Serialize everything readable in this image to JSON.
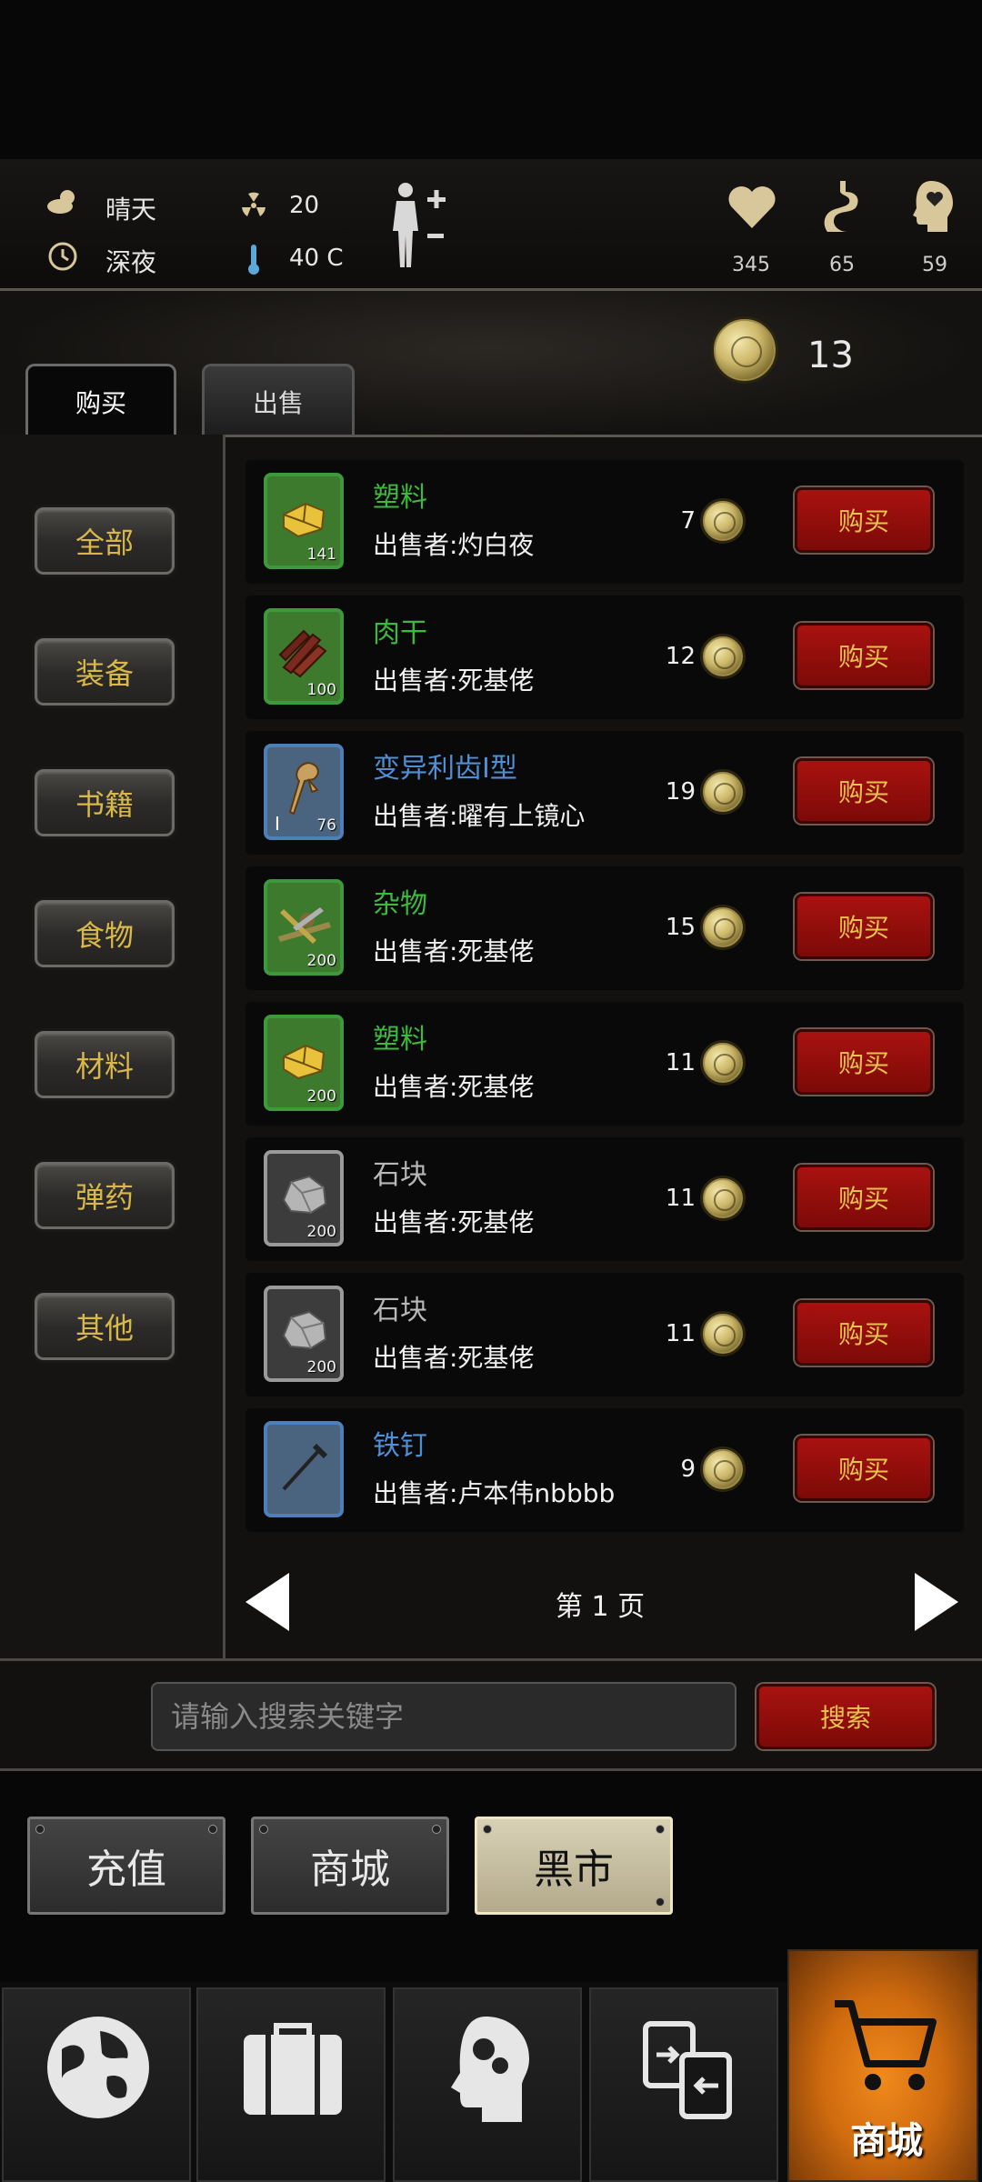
{
  "status": {
    "weather": "晴天",
    "time_of_day": "深夜",
    "radiation": "20",
    "temperature": "40 C",
    "health": "345",
    "hunger": "65",
    "sanity": "59"
  },
  "coins": "13",
  "tabs": {
    "buy": "购买",
    "sell": "出售"
  },
  "categories": [
    "全部",
    "装备",
    "书籍",
    "食物",
    "材料",
    "弹药",
    "其他"
  ],
  "items": [
    {
      "name": "塑料",
      "seller": "出售者:灼白夜",
      "price": "7",
      "qty": "141",
      "name_color": "#3db93d",
      "icon": "plastic-icon"
    },
    {
      "name": "肉干",
      "seller": "出售者:死基佬",
      "price": "12",
      "qty": "100",
      "name_color": "#3db93d",
      "icon": "jerky-icon"
    },
    {
      "name": "变异利齿Ⅰ型",
      "seller": "出售者:曜有上镜心",
      "price": "19",
      "qty": "76",
      "name_color": "#4f8fd6",
      "icon": "fang-icon",
      "tier": "I"
    },
    {
      "name": "杂物",
      "seller": "出售者:死基佬",
      "price": "15",
      "qty": "200",
      "name_color": "#3db93d",
      "icon": "junk-icon"
    },
    {
      "name": "塑料",
      "seller": "出售者:死基佬",
      "price": "11",
      "qty": "200",
      "name_color": "#3db93d",
      "icon": "plastic-icon"
    },
    {
      "name": "石块",
      "seller": "出售者:死基佬",
      "price": "11",
      "qty": "200",
      "name_color": "#b8b8b8",
      "icon": "stone-icon"
    },
    {
      "name": "石块",
      "seller": "出售者:死基佬",
      "price": "11",
      "qty": "200",
      "name_color": "#b8b8b8",
      "icon": "stone-icon"
    },
    {
      "name": "铁钉",
      "seller": "出售者:卢本伟nbbbb",
      "price": "9",
      "qty": "",
      "name_color": "#4f8fd6",
      "icon": "nail-icon"
    }
  ],
  "buy_label": "购买",
  "page_label": "第 1 页",
  "search": {
    "placeholder": "请输入搜索关键字",
    "button": "搜索"
  },
  "modes": {
    "recharge": "充值",
    "store": "商城",
    "black_market": "黑市"
  },
  "nav": {
    "active_label": "商城"
  }
}
